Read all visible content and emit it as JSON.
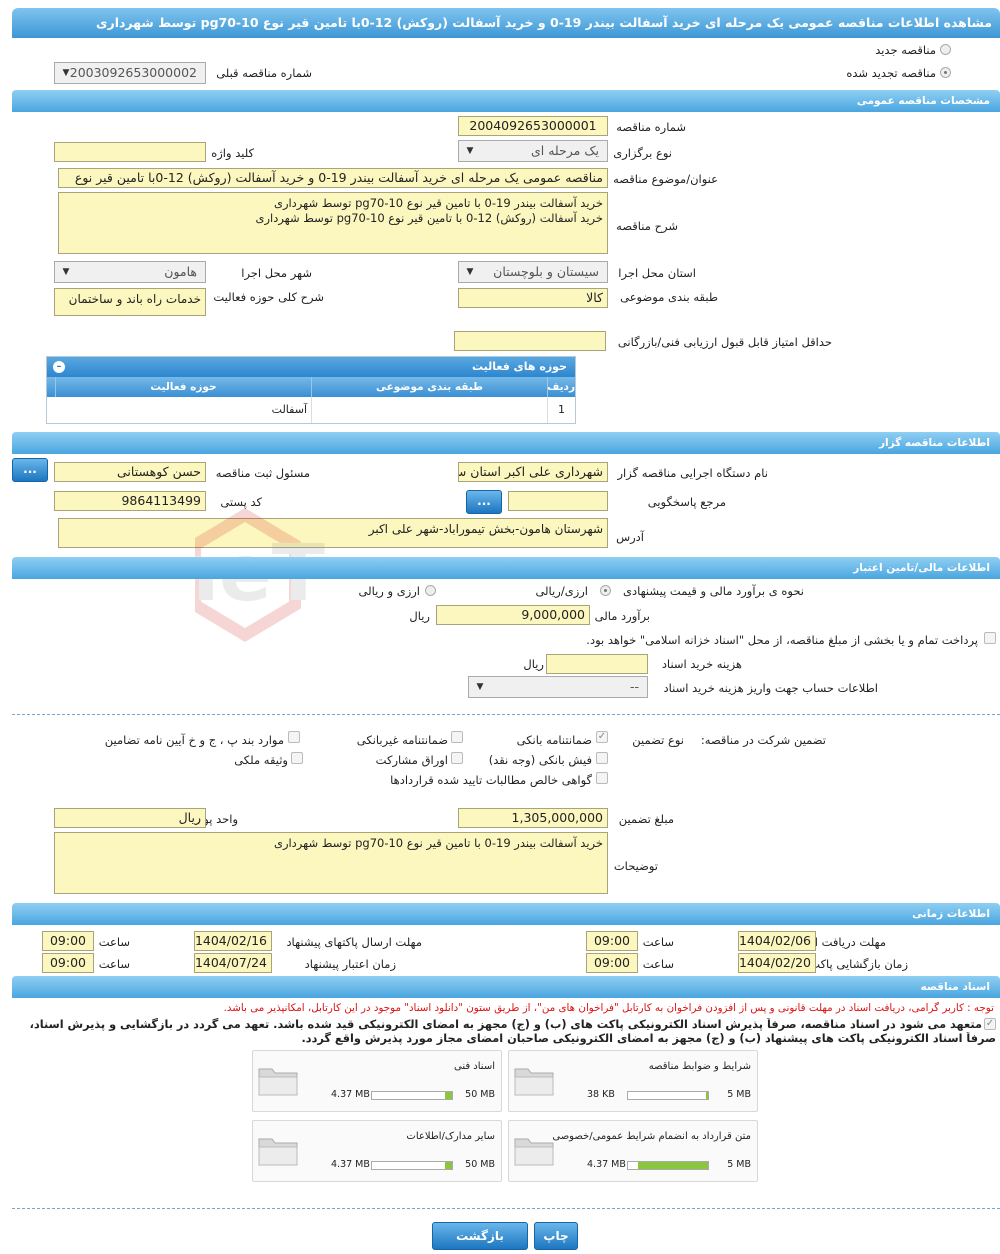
{
  "title": "مشاهده اطلاعات مناقصه عمومی یک مرحله ای خرید آسفالت بیندر 19-0 و خرید آسفالت (روکش) 12-0با تامین قیر نوع pg70-10 توسط شهرداری",
  "tender_type": {
    "new_label": "مناقصه جدید",
    "renewed_label": "مناقصه تجدید شده",
    "prev_number_label": "شماره مناقصه قبلی",
    "prev_number_value": "2003092653000002"
  },
  "general": {
    "section_title": "مشخصات مناقصه عمومی",
    "number_label": "شماره مناقصه",
    "number_value": "2004092653000001",
    "holding_type_label": "نوع برگزاری",
    "holding_type_value": "یک مرحله ای",
    "keyword_label": "کلید واژه",
    "keyword_value": "",
    "subject_label": "عنوان/موضوع مناقصه",
    "subject_value": "مناقصه عمومی یک مرحله ای خرید آسفالت بیندر 19-0 و خرید آسفالت (روکش) 12-0با تامین قیر نوع",
    "desc_label": "شرح مناقصه",
    "desc_line1": "خرید آسفالت بیندر 19-0 با تامین قیر نوع pg70-10 توسط شهرداری",
    "desc_line2": "خرید آسفالت (روکش) 12-0 با تامین قیر نوع pg70-10 توسط شهرداری",
    "province_label": "استان محل اجرا",
    "province_value": "سیستان و بلوچستان",
    "city_label": "شهر محل اجرا",
    "city_value": "هامون",
    "category_label": "طبقه بندی موضوعی",
    "category_value": "کالا",
    "activity_label": "شرح کلی حوزه فعالیت",
    "activity_value": "خدمات راه باند و ساختمان",
    "min_score_label": "حداقل امتیاز قابل قبول ارزیابی فنی/بازرگانی",
    "min_score_value": ""
  },
  "activity_grid": {
    "title": "حوزه های فعالیت",
    "col_row": "ردیف",
    "col_category": "طبقه بندی موضوعی",
    "col_field": "حوزه فعالیت",
    "rows": [
      {
        "row": "1",
        "category": "",
        "field": "آسفالت"
      }
    ]
  },
  "organizer": {
    "section_title": "اطلاعات مناقصه گزار",
    "org_label": "نام دستگاه اجرایی مناقصه گزار",
    "org_value": "شهرداری علی اکبر استان س",
    "registrar_label": "مسئول ثبت مناقصه",
    "registrar_value": "حسن کوهستانی",
    "ref_label": "مرجع پاسخگویی",
    "ref_value": "",
    "postal_label": "کد پستی",
    "postal_value": "9864113499",
    "address_label": "آدرس",
    "address_value": "شهرستان هامون-بخش تیموراباد-شهر علی اکبر",
    "dots": "..."
  },
  "finance": {
    "section_title": "اطلاعات مالی/تامین اعتبار",
    "method_label": "نحوه ی برآورد مالی و قیمت پیشنهادی",
    "opt1": "ارزی/ریالی",
    "opt2": "ارزی و ریالی",
    "estimate_label": "برآورد مالی",
    "estimate_value": "9,000,000",
    "currency": "ریال",
    "treasury_text": "پرداخت تمام و یا بخشی از مبلغ مناقصه، از محل \"اسناد خزانه اسلامی\" خواهد بود.",
    "doc_fee_label": "هزینه خرید اسناد",
    "doc_fee_value": "",
    "doc_fee_unit": "ریال",
    "account_label": "اطلاعات حساب جهت واریز هزینه خرید اسناد",
    "account_value": "--"
  },
  "guarantee": {
    "label": "تضمین شرکت در مناقصه:",
    "type_label": "نوع تضمین",
    "bank": "ضمانتنامه بانکی",
    "nonbank": "ضمانتنامه غیربانکی",
    "clauses": "موارد بند پ ، ج و خ آیین نامه تضامین",
    "receipt": "فیش بانکی (وجه نقد)",
    "bonds": "اوراق مشارکت",
    "property": "وثیقه ملکی",
    "claims": "گواهی خالص مطالبات تایید شده قراردادها",
    "amount_label": "مبلغ تضمین",
    "amount_value": "1,305,000,000",
    "unit_label": "واحد پول",
    "unit_value": "ریال",
    "notes_label": "توضیحات",
    "notes_value": "خرید آسفالت بیندر 19-0 با تامین قیر نوع pg70-10 توسط شهرداری"
  },
  "timing": {
    "section_title": "اطلاعات زمانی",
    "receive_label": "مهلت دریافت اسناد",
    "receive_date": "1404/02/06",
    "receive_time": "09:00",
    "send_label": "مهلت ارسال پاکتهای پیشنهاد",
    "send_date": "1404/02/16",
    "send_time": "09:00",
    "open_label": "زمان بازگشایی پاکت ها",
    "open_date": "1404/02/20",
    "open_time": "09:00",
    "valid_label": "زمان اعتبار پیشنهاد",
    "valid_date": "1404/07/24",
    "valid_time": "09:00",
    "time_label": "ساعت"
  },
  "documents": {
    "section_title": "اسناد مناقصه",
    "notice": "توجه : کاربر گرامی، دریافت اسناد در مهلت قانونی و پس از افزودن فراخوان به کارتابل \"فراخوان های من\"، از طریق ستون \"دانلود اسناد\" موجود در این کارتابل، امکانپذیر می باشد.",
    "commit_line1": "متعهد می شود در اسناد مناقصه، صرفاً پذیرش اسناد الکترونیکی پاکت های (ب) و (ج) مجهز به امضای الکترونیکی قید شده باشد. تعهد می گردد در بازگشایی و پذیرش اسناد،",
    "commit_line2": "صرفاً اسناد الکترونیکی پاکت های پیشنهاد (ب) و (ج) مجهز به امضای الکترونیکی صاحبان امضای مجاز مورد پذیرش واقع گردد.",
    "items": [
      {
        "title": "شرایط و ضوابط مناقصه",
        "current": "38 KB",
        "max": "5 MB",
        "fill": 0.02
      },
      {
        "title": "اسناد فنی",
        "current": "4.37 MB",
        "max": "50 MB",
        "fill": 0.09
      },
      {
        "title": "متن قرارداد به انضمام شرایط عمومی/خصوصی",
        "current": "4.37 MB",
        "max": "5 MB",
        "fill": 0.87
      },
      {
        "title": "سایر مدارک/اطلاعات",
        "current": "4.37 MB",
        "max": "50 MB",
        "fill": 0.09
      }
    ]
  },
  "actions": {
    "print": "چاپ",
    "back": "بازگشت"
  },
  "colors": {
    "header": "#3d97d6",
    "field": "#fcf7bf",
    "progress": "#8cc63f",
    "notice": "#dd1111"
  }
}
